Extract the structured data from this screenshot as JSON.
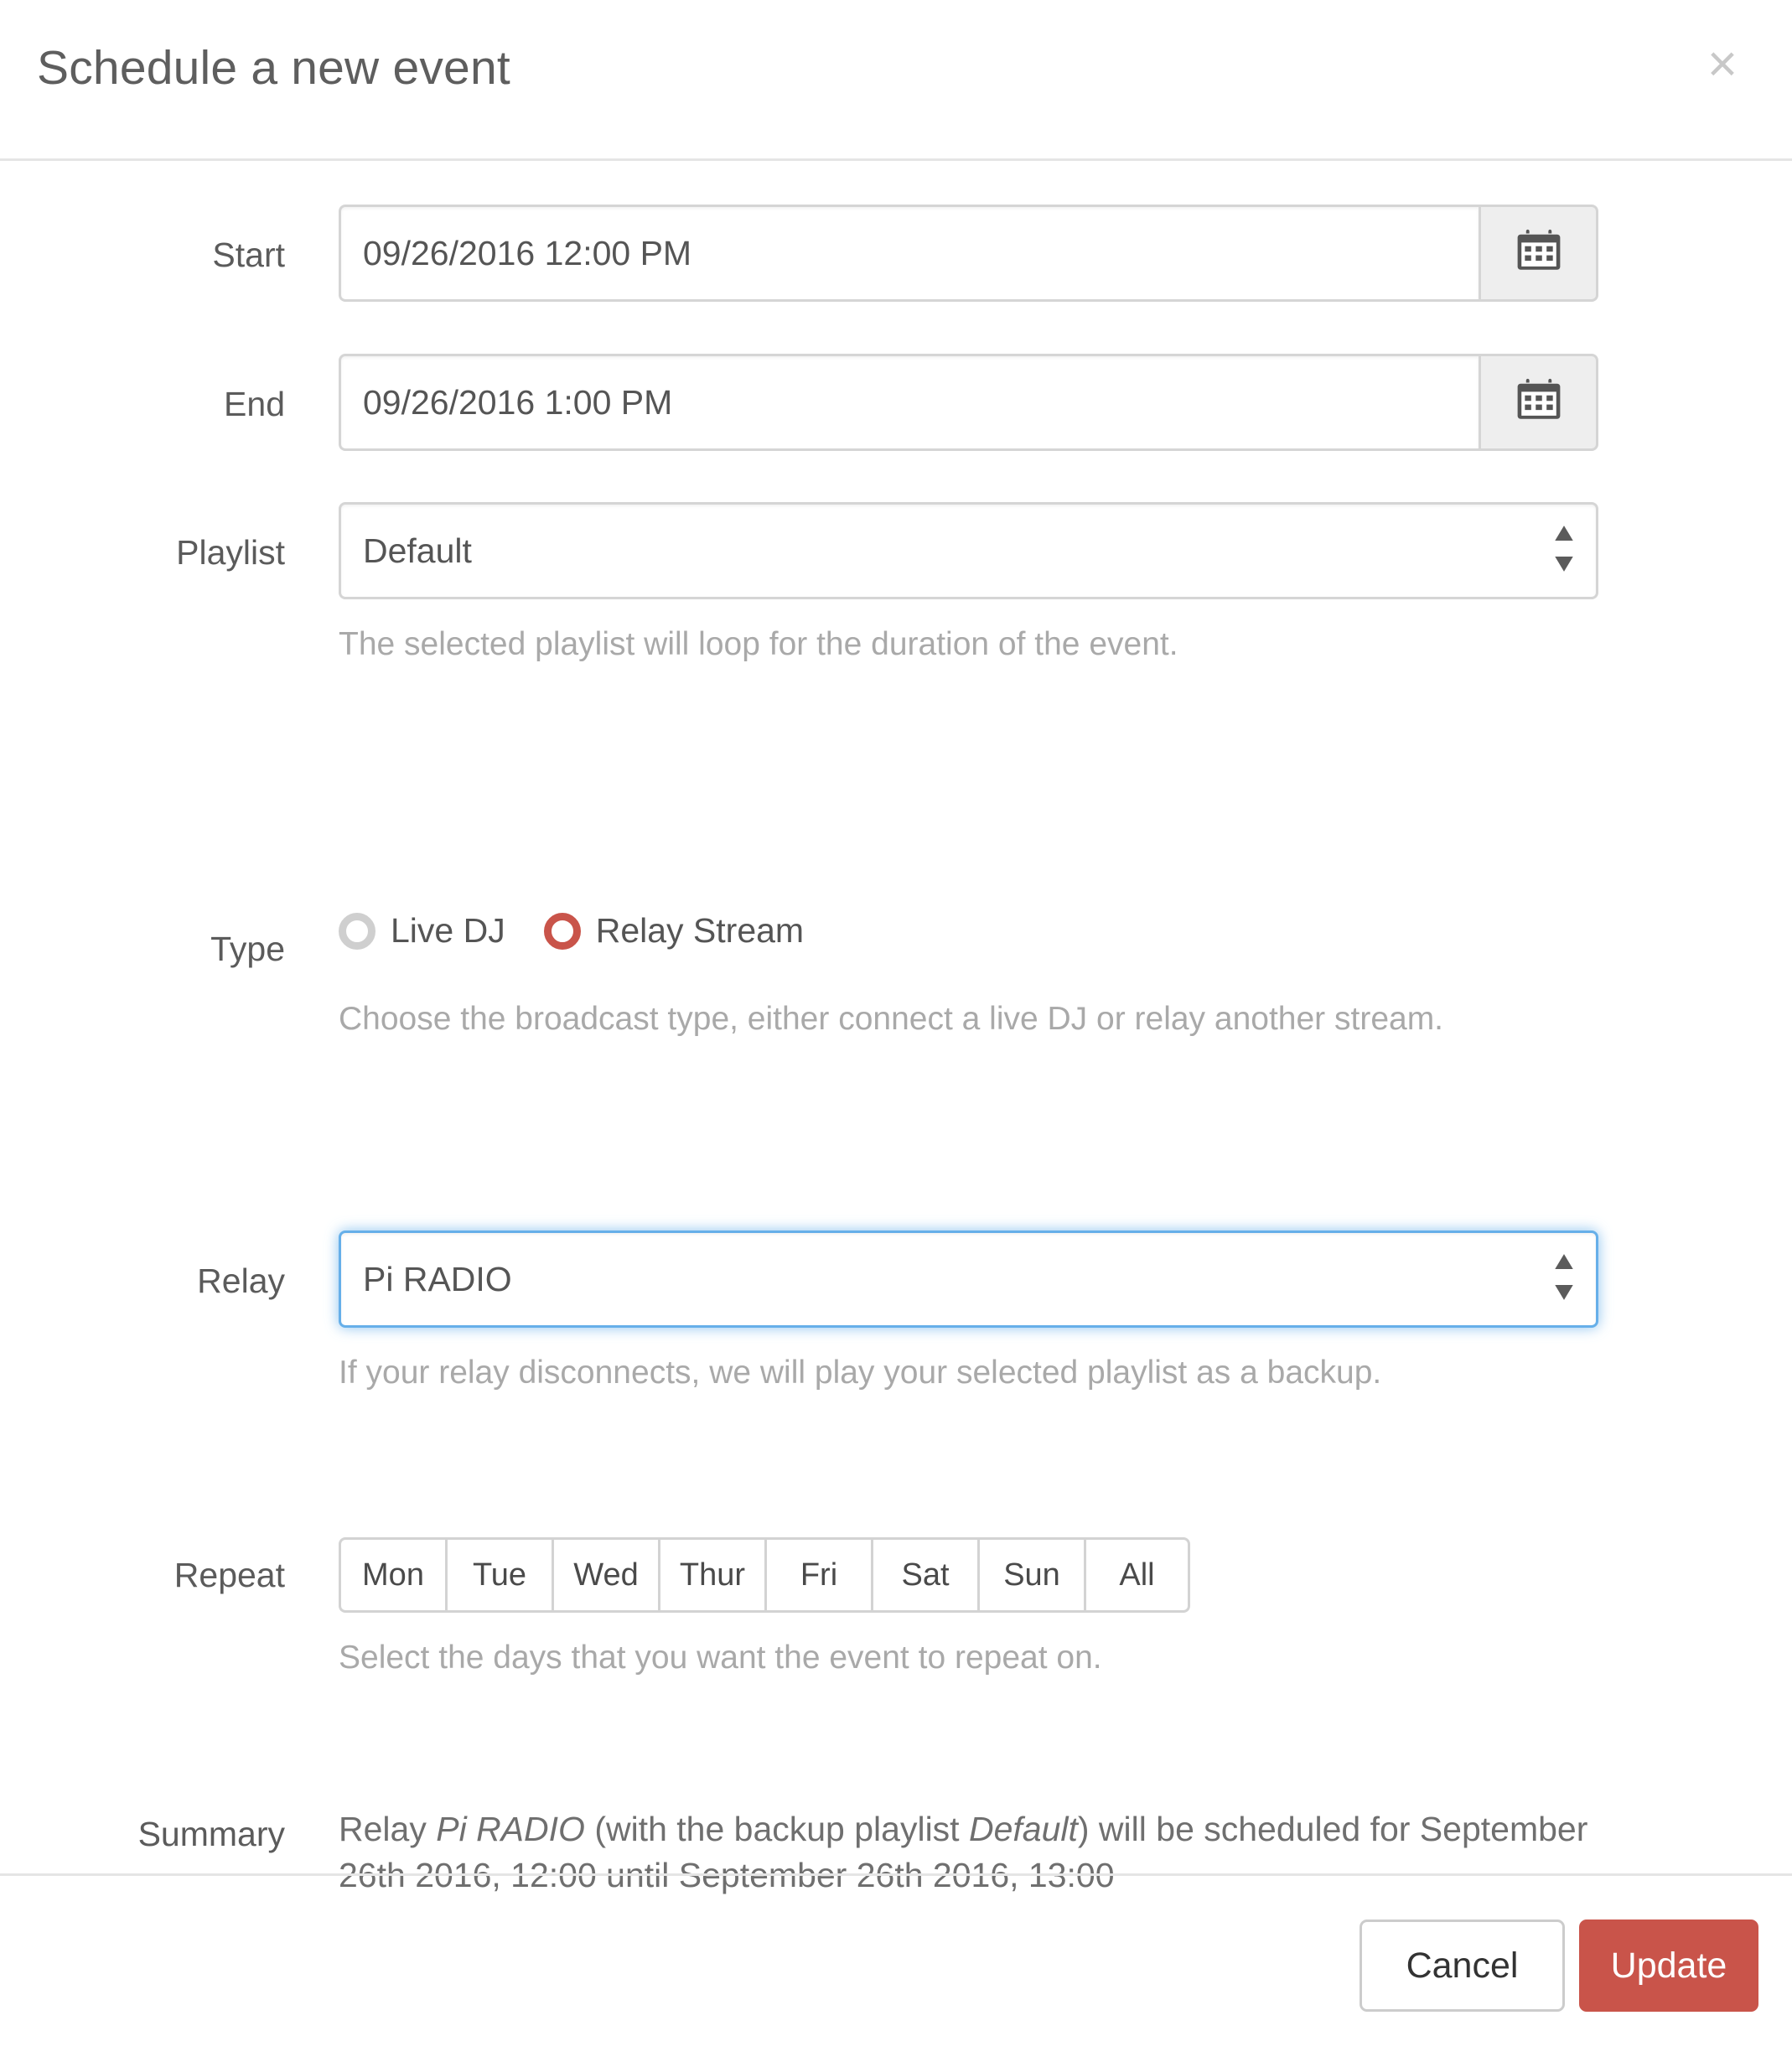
{
  "header": {
    "title": "Schedule a new event",
    "close_label": "×"
  },
  "form": {
    "start": {
      "label": "Start",
      "value": "09/26/2016 12:00 PM",
      "placeholder": "",
      "addon_icon": "calendar-icon"
    },
    "end": {
      "label": "End",
      "value": "09/26/2016 1:00 PM",
      "placeholder": "",
      "addon_icon": "calendar-icon"
    },
    "playlist": {
      "label": "Playlist",
      "value": "Default",
      "options": [
        "Default"
      ],
      "help": "The selected playlist will loop for the duration of the event."
    },
    "type": {
      "label": "Type",
      "help": "Choose the broadcast type, either connect a live DJ or relay another stream.",
      "options": [
        {
          "label": "Live DJ",
          "checked": false
        },
        {
          "label": "Relay Stream",
          "checked": true
        }
      ]
    },
    "relay": {
      "label": "Relay",
      "value": "Pi RADIO",
      "options": [
        "Pi RADIO"
      ],
      "help": "If your relay disconnects, we will play your selected playlist as a backup.",
      "focused": true
    },
    "repeat": {
      "label": "Repeat",
      "help": "Select the days that you want the event to repeat on.",
      "days": [
        {
          "label": "Mon",
          "active": false
        },
        {
          "label": "Tue",
          "active": false
        },
        {
          "label": "Wed",
          "active": false
        },
        {
          "label": "Thur",
          "active": false
        },
        {
          "label": "Fri",
          "active": false
        },
        {
          "label": "Sat",
          "active": false
        },
        {
          "label": "Sun",
          "active": false
        },
        {
          "label": "All",
          "active": false
        }
      ]
    },
    "summary": {
      "label": "Summary",
      "prefix": "Relay ",
      "relay_name": "Pi RADIO",
      "middle": " (with the backup playlist ",
      "playlist_name": "Default",
      "suffix": ") will be scheduled for September 26th 2016, 12:00 until September 26th 2016, 13:00"
    }
  },
  "footer": {
    "cancel_label": "Cancel",
    "update_label": "Update"
  },
  "colors": {
    "accent_red": "#c9544a",
    "focus_blue": "#66afe9",
    "border_gray": "#d5d5d5",
    "help_gray": "#a9a9a9",
    "title_gray": "#5e5e5e"
  }
}
